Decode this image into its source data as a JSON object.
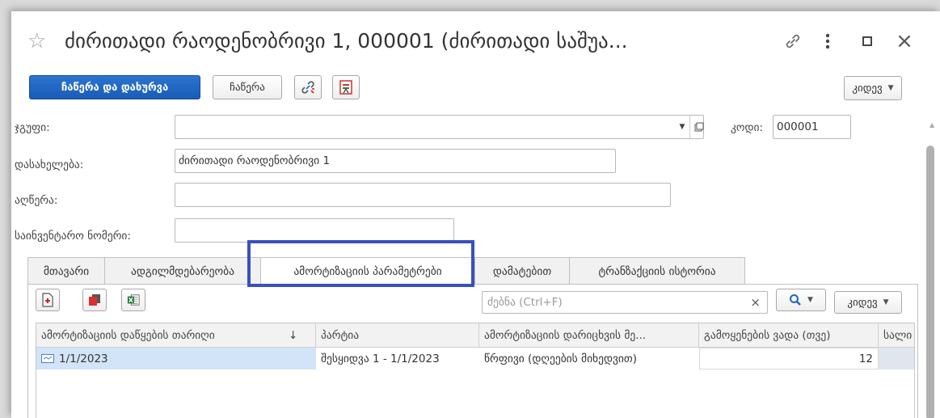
{
  "title": "ძირითადი რაოდენობრივი 1, 000001 (ძირითადი საშუა...",
  "toolbar": {
    "save_close": "ჩაწერა და დახურვა",
    "save": "ჩაწერა",
    "more": "კიდევ"
  },
  "form": {
    "group_label": "ჯგუფი:",
    "group_value": "",
    "code_label": "კოდი:",
    "code_value": "000001",
    "name_label": "დასახელება:",
    "name_value": "ძირითადი რაოდენობრივი 1",
    "desc_label": "აღწერა:",
    "desc_value": "",
    "inv_label": "საინვენტარო ნომერი:",
    "inv_value": ""
  },
  "tabs": [
    {
      "label": "მთავარი"
    },
    {
      "label": "ადგილმდებარეობა"
    },
    {
      "label": "ამორტიზაციის პარამეტრები"
    },
    {
      "label": "დამატებით"
    },
    {
      "label": "ტრანზაქციის ისტორია"
    }
  ],
  "active_tab": "ამორტიზაციის პარამეტრები",
  "search": {
    "placeholder": "ძებნა (Ctrl+F)"
  },
  "table_more": "კიდევ",
  "table": {
    "columns": [
      "ამორტიზაციის დაწყების თარიღი",
      "პარტია",
      "ამორტიზაციის დარიცხვის მე...",
      "გამოყენების ვადა (თვე)",
      "სალი"
    ],
    "sort_indicator": "↓",
    "rows": [
      {
        "date": "1/1/2023",
        "batch": "შესყიდვა 1 - 1/1/2023",
        "method": "წრფივი (დღეების მიხედვით)",
        "term": "12",
        "extra": ""
      }
    ]
  },
  "colors": {
    "primary": "#1f64c4",
    "highlight": "#3a4fc0",
    "selected_row": "#d2e4f7"
  }
}
